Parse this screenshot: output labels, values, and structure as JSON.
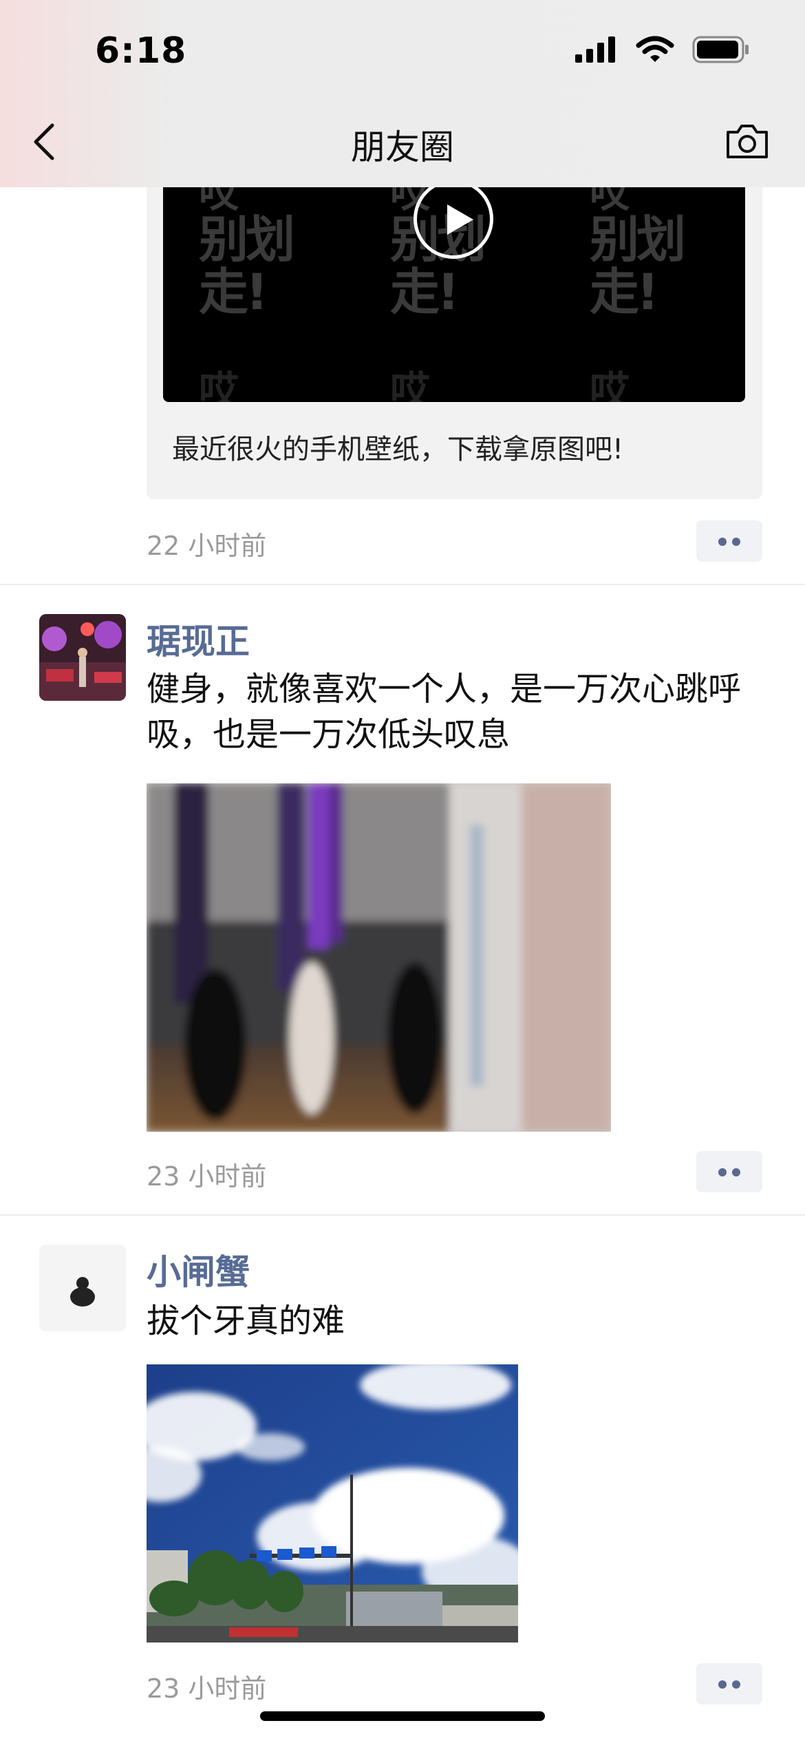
{
  "status_bar": {
    "time": "6:18"
  },
  "nav": {
    "title": "朋友圈"
  },
  "video_watermark": {
    "line1": "哎",
    "line2": "别划走!",
    "line3": "哎"
  },
  "posts": [
    {
      "share_text": "最近很火的手机壁纸，下载拿原图吧!",
      "time": "22 小时前"
    },
    {
      "user": "琚现正",
      "text": "健身，就像喜欢一个人，是一万次心跳呼吸，也是一万次低头叹息",
      "time": "23 小时前"
    },
    {
      "user": "小闸蟹",
      "text": "拔个牙真的难",
      "time": "23 小时前"
    }
  ],
  "colors": {
    "username": "#576b95",
    "timestamp": "#9a9a9a",
    "background": "#ffffff",
    "nav_bg": "#ededed"
  }
}
